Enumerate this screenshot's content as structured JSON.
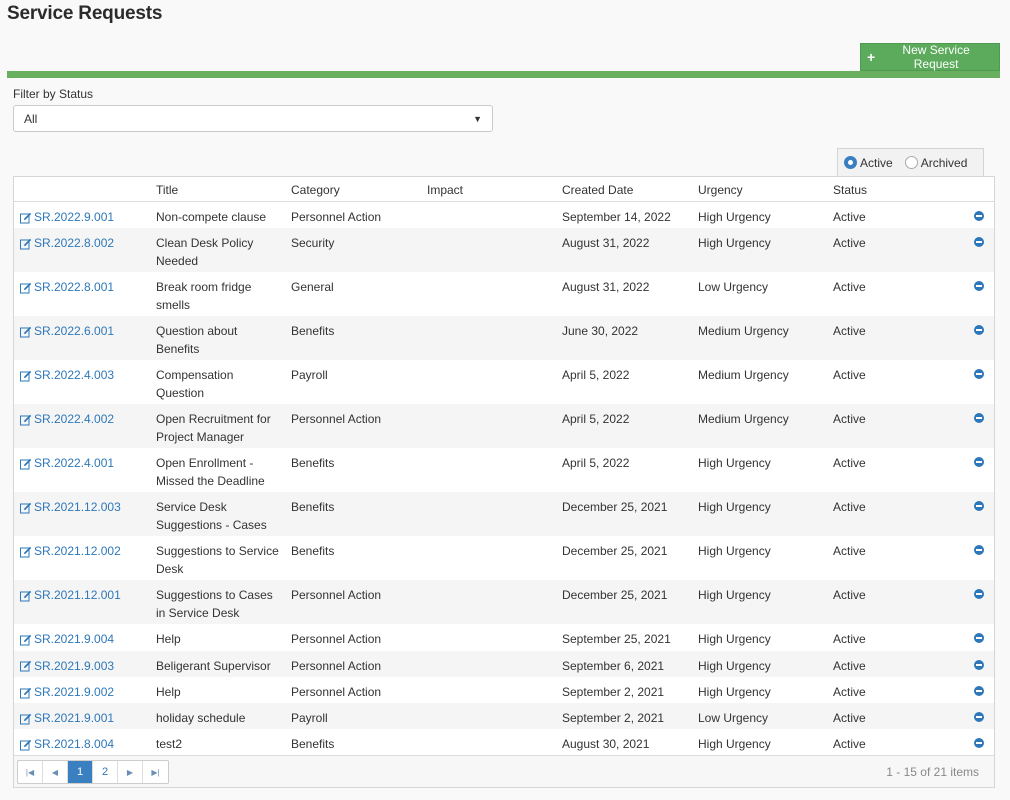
{
  "page": {
    "title": "Service Requests"
  },
  "toolbar": {
    "new_button_label": "New Service Request",
    "new_button_icon": "plus-icon"
  },
  "filter": {
    "label": "Filter by Status",
    "selected": "All"
  },
  "toggle": {
    "active_label": "Active",
    "archived_label": "Archived",
    "selected": "Active"
  },
  "grid": {
    "columns": [
      "",
      "Title",
      "Category",
      "Impact",
      "Created Date",
      "Urgency",
      "Status"
    ],
    "rows": [
      {
        "id": "SR.2022.9.001",
        "title": "Non-compete clause",
        "category": "Personnel Action",
        "impact": "",
        "created": "September 14, 2022",
        "urgency": "High Urgency",
        "status": "Active"
      },
      {
        "id": "SR.2022.8.002",
        "title": "Clean Desk Policy Needed",
        "category": "Security",
        "impact": "",
        "created": "August 31, 2022",
        "urgency": "High Urgency",
        "status": "Active"
      },
      {
        "id": "SR.2022.8.001",
        "title": "Break room fridge smells",
        "category": "General",
        "impact": "",
        "created": "August 31, 2022",
        "urgency": "Low Urgency",
        "status": "Active"
      },
      {
        "id": "SR.2022.6.001",
        "title": "Question about Benefits",
        "category": "Benefits",
        "impact": "",
        "created": "June 30, 2022",
        "urgency": "Medium Urgency",
        "status": "Active"
      },
      {
        "id": "SR.2022.4.003",
        "title": "Compensation Question",
        "category": "Payroll",
        "impact": "",
        "created": "April 5, 2022",
        "urgency": "Medium Urgency",
        "status": "Active"
      },
      {
        "id": "SR.2022.4.002",
        "title": "Open Recruitment for Project Manager",
        "category": "Personnel Action",
        "impact": "",
        "created": "April 5, 2022",
        "urgency": "Medium Urgency",
        "status": "Active"
      },
      {
        "id": "SR.2022.4.001",
        "title": "Open Enrollment - Missed the Deadline",
        "category": "Benefits",
        "impact": "",
        "created": "April 5, 2022",
        "urgency": "High Urgency",
        "status": "Active"
      },
      {
        "id": "SR.2021.12.003",
        "title": "Service Desk Suggestions - Cases",
        "category": "Benefits",
        "impact": "",
        "created": "December 25, 2021",
        "urgency": "High Urgency",
        "status": "Active"
      },
      {
        "id": "SR.2021.12.002",
        "title": "Suggestions to Service Desk",
        "category": "Benefits",
        "impact": "",
        "created": "December 25, 2021",
        "urgency": "High Urgency",
        "status": "Active"
      },
      {
        "id": "SR.2021.12.001",
        "title": "Suggestions to Cases in Service Desk",
        "category": "Personnel Action",
        "impact": "",
        "created": "December 25, 2021",
        "urgency": "High Urgency",
        "status": "Active"
      },
      {
        "id": "SR.2021.9.004",
        "title": "Help",
        "category": "Personnel Action",
        "impact": "",
        "created": "September 25, 2021",
        "urgency": "High Urgency",
        "status": "Active"
      },
      {
        "id": "SR.2021.9.003",
        "title": "Beligerant Supervisor",
        "category": "Personnel Action",
        "impact": "",
        "created": "September 6, 2021",
        "urgency": "High Urgency",
        "status": "Active"
      },
      {
        "id": "SR.2021.9.002",
        "title": "Help",
        "category": "Personnel Action",
        "impact": "",
        "created": "September 2, 2021",
        "urgency": "High Urgency",
        "status": "Active"
      },
      {
        "id": "SR.2021.9.001",
        "title": "holiday schedule",
        "category": "Payroll",
        "impact": "",
        "created": "September 2, 2021",
        "urgency": "Low Urgency",
        "status": "Active"
      },
      {
        "id": "SR.2021.8.004",
        "title": "test2",
        "category": "Benefits",
        "impact": "",
        "created": "August 30, 2021",
        "urgency": "High Urgency",
        "status": "Active"
      }
    ]
  },
  "pager": {
    "pages": [
      "1",
      "2"
    ],
    "current_page": "1",
    "info": "1 - 15 of 21 items"
  },
  "colors": {
    "accent": "#2e78b9",
    "green": "#5cab5c",
    "bar": "#68b05f"
  }
}
